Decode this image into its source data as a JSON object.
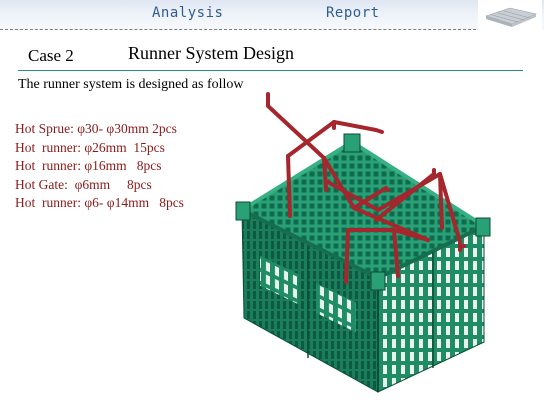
{
  "header": {
    "nav": [
      "Analysis",
      "Report"
    ]
  },
  "case_label": "Case 2",
  "title": "Runner System Design",
  "intro": "The runner system is designed  as follow",
  "specs": [
    "Hot Sprue: φ30- φ30mm 2pcs",
    "Hot  runner: φ26mm  15pcs",
    "Hot  runner: φ16mm   8pcs",
    "Hot Gate:  φ6mm     8pcs",
    "Hot  runner: φ6- φ14mm   8pcs"
  ],
  "colors": {
    "model": "#1f8c66",
    "runner": "#a5262c",
    "spec_text": "#8b1a1a",
    "nav_text": "#2f5f8f",
    "title_rule": "#2e8b7c"
  }
}
